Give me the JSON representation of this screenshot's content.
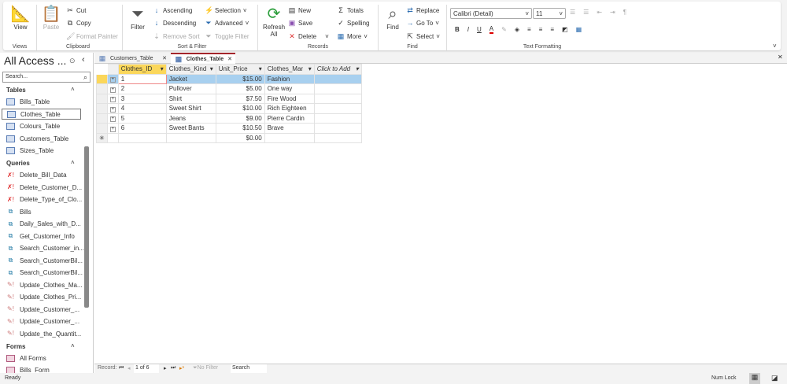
{
  "ribbon": {
    "views": {
      "view": "View",
      "label": "Views"
    },
    "clipboard": {
      "paste": "Paste",
      "cut": "Cut",
      "copy": "Copy",
      "format_painter": "Format Painter",
      "label": "Clipboard"
    },
    "sort_filter": {
      "filter": "Filter",
      "ascending": "Ascending",
      "descending": "Descending",
      "remove_sort": "Remove Sort",
      "selection": "Selection",
      "advanced": "Advanced",
      "toggle_filter": "Toggle Filter",
      "label": "Sort & Filter"
    },
    "records": {
      "refresh": "Refresh",
      "refresh2": "All",
      "new": "New",
      "save": "Save",
      "delete": "Delete",
      "totals": "Totals",
      "spelling": "Spelling",
      "more": "More",
      "label": "Records"
    },
    "find": {
      "find": "Find",
      "replace": "Replace",
      "goto": "Go To",
      "select": "Select",
      "label": "Find"
    },
    "text_formatting": {
      "font": "Calibri (Detail)",
      "size": "11",
      "bold": "B",
      "italic": "I",
      "underline": "U",
      "label": "Text Formatting"
    }
  },
  "nav": {
    "title": "All Access ...",
    "search_placeholder": "Search...",
    "sections": [
      {
        "label": "Tables",
        "items": [
          "Bills_Table",
          "Clothes_Table",
          "Colours_Table",
          "Customers_Table",
          "Sizes_Table"
        ]
      },
      {
        "label": "Queries",
        "items": [
          "Delete_Bill_Data",
          "Delete_Customer_D...",
          "Delete_Type_of_Clo...",
          "Bills",
          "Daily_Sales_with_D...",
          "Get_Customer_Info",
          "Search_Customer_in...",
          "Search_CustomerBil...",
          "Search_CustomerBil...",
          "Update_Clothes_Ma...",
          "Update_Clothes_Pri...",
          "Update_Customer_...",
          "Update_Customer_...",
          "Update_the_Quantit..."
        ]
      },
      {
        "label": "Forms",
        "items": [
          "All Forms",
          "Bills_Form"
        ]
      }
    ]
  },
  "tabs": [
    "Customers_Table",
    "Clothes_Table"
  ],
  "table": {
    "columns": [
      "Clothes_ID",
      "Clothes_Kind",
      "Unit_Price",
      "Clothes_Mar",
      "Click to Add"
    ],
    "rows": [
      [
        "1",
        "Jacket",
        "$15.00",
        "Fashion"
      ],
      [
        "2",
        "Pullover",
        "$5.00",
        "One way"
      ],
      [
        "3",
        "Shirt",
        "$7.50",
        "Fire Wood"
      ],
      [
        "4",
        "Sweet Shirt",
        "$10.00",
        "Rich Eighteen"
      ],
      [
        "5",
        "Jeans",
        "$9.00",
        "Pierre Cardin"
      ],
      [
        "6",
        "Sweet Bants",
        "$10.50",
        "Brave"
      ]
    ],
    "new_row_price": "$0.00"
  },
  "record_nav": {
    "label": "Record:",
    "position": "1 of 6",
    "no_filter": "No Filter",
    "search": "Search"
  },
  "status": {
    "left": "Ready",
    "num_lock": "Num Lock"
  }
}
